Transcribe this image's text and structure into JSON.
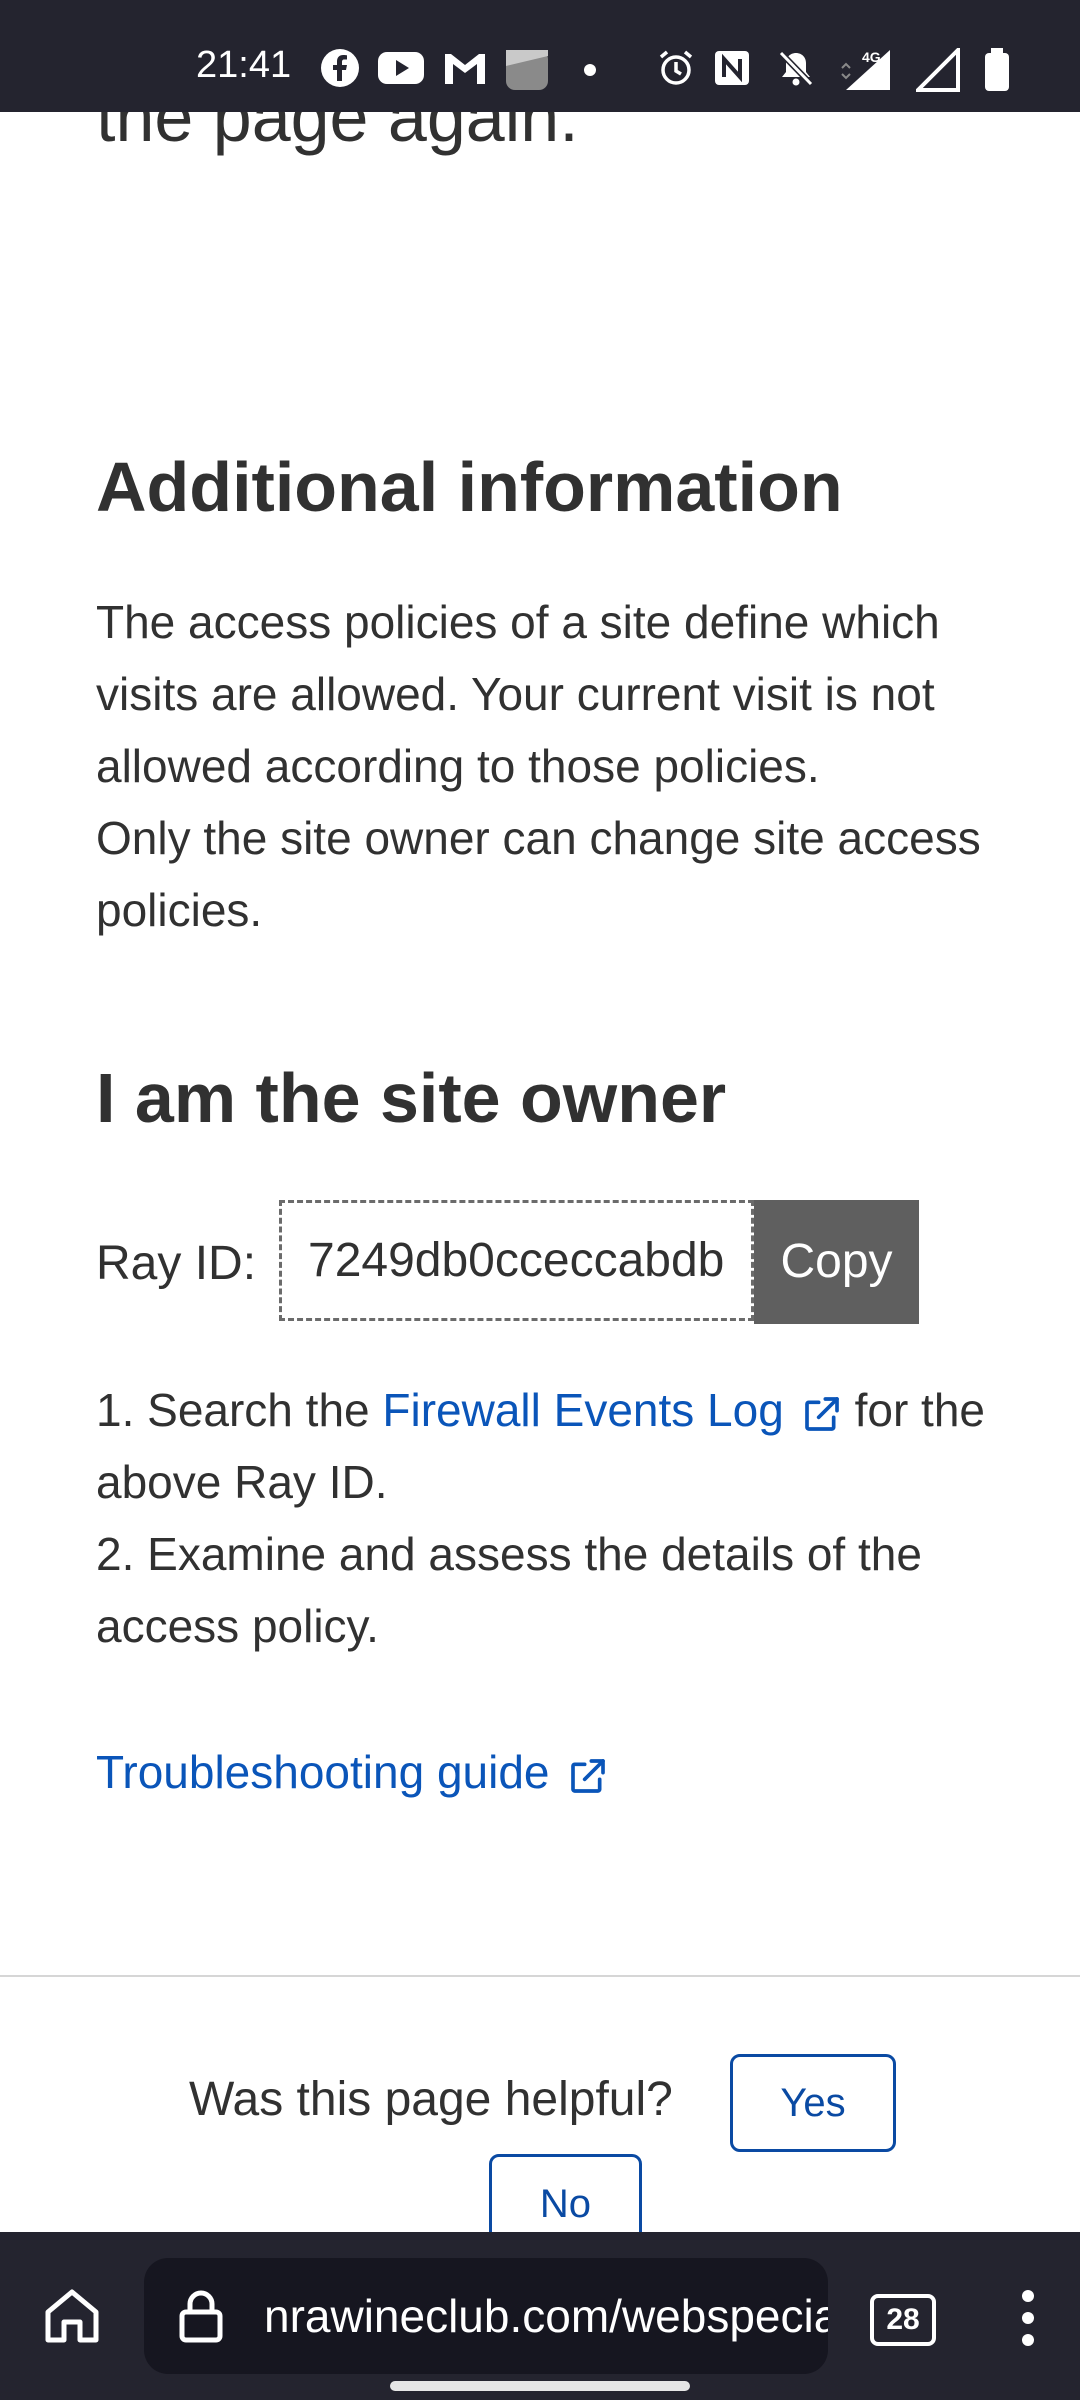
{
  "status_bar": {
    "time": "21:41",
    "network": "4G",
    "icons": [
      "facebook-icon",
      "youtube-icon",
      "gmail-icon",
      "photo-app-icon",
      "dot-icon",
      "alarm-icon",
      "nfc-icon",
      "bell-off-icon",
      "signal-icon",
      "signal-icon",
      "battery-icon"
    ]
  },
  "content": {
    "cut_title": "the page again.",
    "additional_heading": "Additional information",
    "access_para_1": "The access policies of a site define which visits are allowed. Your current visit is not allowed according to those policies.",
    "access_para_2": "Only the site owner can change site access policies.",
    "owner_heading": "I am the site owner",
    "ray_label": "Ray ID:",
    "ray_value": "7249db0cceccabdb",
    "copy_label": "Copy",
    "step1_prefix": "1.  Search the ",
    "step1_link": "Firewall Events Log",
    "step1_suffix": " for the above Ray ID.",
    "step2": "2. Examine and assess the details of the access policy.",
    "troubleshoot_link": "Troubleshooting guide",
    "helpful_question": "Was this page helpful?",
    "yes_label": "Yes",
    "no_label": "No"
  },
  "browser_bar": {
    "url": "nrawineclub.com/webspecials",
    "tab_count": "28"
  },
  "colors": {
    "link": "#0a55b9",
    "bar_bg": "#24242f",
    "copy_bg": "#5f5f5f"
  }
}
